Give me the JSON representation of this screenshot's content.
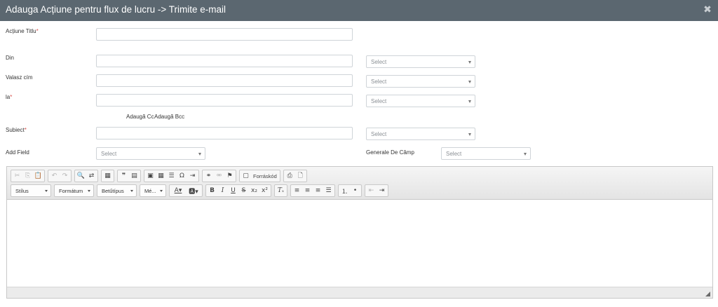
{
  "dialog": {
    "title": "Adauga Acțiune pentru flux de lucru -> Trimite e-mail",
    "close_icon": "close-icon"
  },
  "form": {
    "action_title_label": "Acțiune Titlu",
    "required_mark": "*",
    "from_label": "Din",
    "reply_to_label": "Valasz cím",
    "to_label": "la",
    "add_cc": "Adaugă Cc",
    "add_bcc": "Adaugă Bcc",
    "subject_label": "Subiect",
    "add_field_label": "Add Field",
    "field_defaults_label": "Generale De Câmp",
    "select_placeholder": "Select",
    "action_title_value": "",
    "from_value": "",
    "reply_to_value": "",
    "to_value": "",
    "subject_value": ""
  },
  "editor": {
    "combos": {
      "style": "Stílus",
      "format": "Formátum",
      "font": "Betűtípus",
      "size": "Mé..."
    },
    "source_label": "Forráskód",
    "icons": [
      "cut-icon",
      "copy-icon",
      "paste-icon",
      "undo-icon",
      "redo-icon",
      "find-icon",
      "replace-icon",
      "select-all-icon",
      "blockquote-icon",
      "creatediv-icon",
      "image-icon",
      "table-icon",
      "horizontal-rule-icon",
      "special-char-icon",
      "indent-list-icon",
      "link-icon",
      "unlink-icon",
      "anchor-icon",
      "source-icon",
      "templates-icon",
      "preview-icon",
      "text-color-icon",
      "background-color-icon",
      "bold-icon",
      "italic-icon",
      "underline-icon",
      "strike-icon",
      "subscript-icon",
      "superscript-icon",
      "remove-format-icon",
      "align-left-icon",
      "align-center-icon",
      "align-right-icon",
      "justify-icon",
      "numbered-list-icon",
      "bulleted-list-icon",
      "outdent-icon",
      "indent-icon",
      "resize-handle-icon"
    ]
  },
  "colors": {
    "titlebar": "#5b6770",
    "required": "#d9534f",
    "border": "#cfd4d8"
  }
}
